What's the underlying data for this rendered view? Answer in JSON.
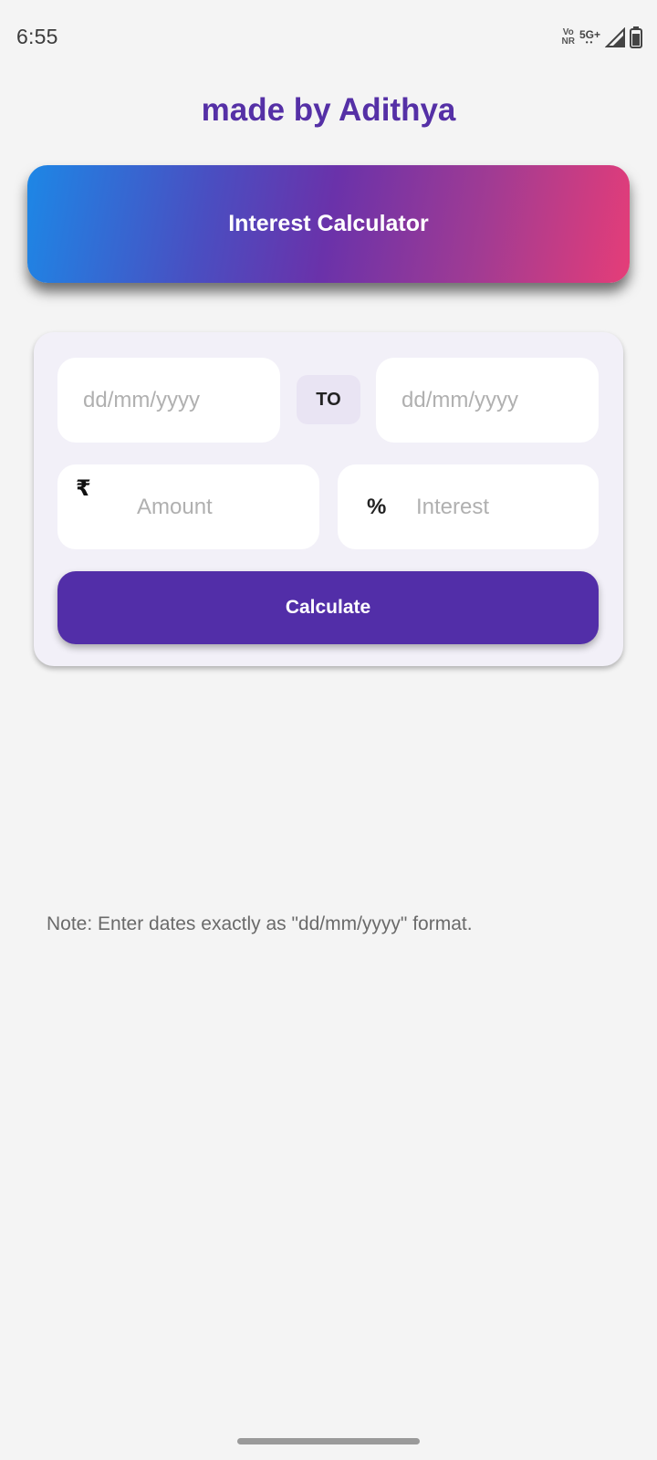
{
  "status_bar": {
    "time": "6:55",
    "volte_line1": "Vo",
    "volte_line2": "NR",
    "network": "5G+",
    "signal_icon": "signal-icon",
    "battery_icon": "battery-icon"
  },
  "header": {
    "credit": "made by Adithya"
  },
  "banner": {
    "title": "Interest Calculator"
  },
  "form": {
    "from_date_placeholder": "dd/mm/yyyy",
    "to_label": "TO",
    "to_date_placeholder": "dd/mm/yyyy",
    "amount_icon": "₹",
    "amount_placeholder": "Amount",
    "interest_icon": "%",
    "interest_placeholder": "Interest",
    "calculate_label": "Calculate"
  },
  "note": "Note: Enter dates exactly as \"dd/mm/yyyy\" format.",
  "colors": {
    "accent": "#522ea8",
    "title": "#5530a6",
    "gradient_start": "#1d87e6",
    "gradient_end": "#e53d78"
  }
}
